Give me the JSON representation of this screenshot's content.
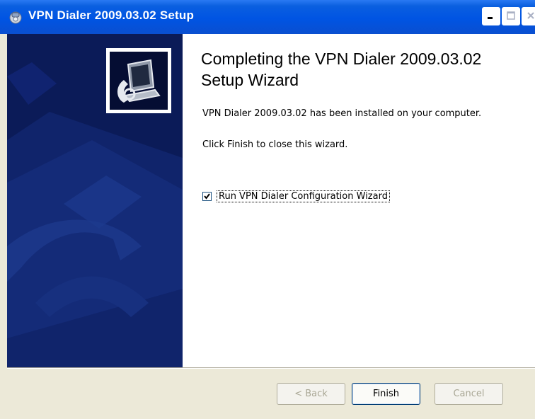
{
  "window": {
    "title": "VPN Dialer 2009.03.02 Setup",
    "icon": "installer-icon"
  },
  "titlebar_buttons": {
    "minimize": "minimize-icon",
    "maximize": "maximize-icon",
    "close": "close-icon"
  },
  "main": {
    "heading": "Completing the VPN Dialer 2009.03.02 Setup Wizard",
    "installed_text": "VPN Dialer 2009.03.02 has been installed on your computer.",
    "finish_hint": "Click Finish to close this wizard.",
    "run_checkbox": {
      "label": "Run VPN Dialer Configuration Wizard",
      "checked": true
    }
  },
  "buttons": {
    "back": "< Back",
    "finish": "Finish",
    "cancel": "Cancel"
  },
  "colors": {
    "titlebar": "#0054e3",
    "side_panel": "#0a1a57",
    "dialog_bg": "#ece9d8"
  }
}
